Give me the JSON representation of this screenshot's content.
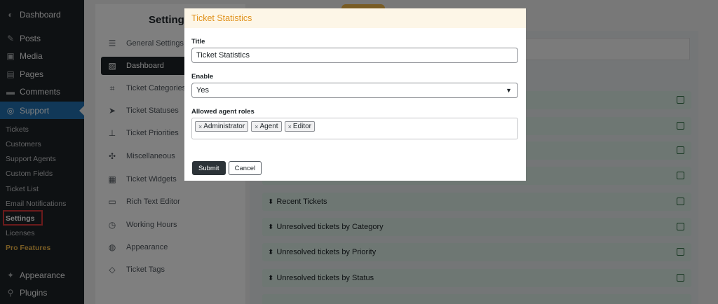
{
  "wp_menu": [
    {
      "label": "Dashboard",
      "icon": "dashboard-icon",
      "glyph": "◐"
    },
    {
      "label": "Posts",
      "icon": "pin-icon",
      "glyph": "✎"
    },
    {
      "label": "Media",
      "icon": "media-icon",
      "glyph": "▣"
    },
    {
      "label": "Pages",
      "icon": "pages-icon",
      "glyph": "▤"
    },
    {
      "label": "Comments",
      "icon": "comments-icon",
      "glyph": "▬"
    },
    {
      "label": "Support",
      "icon": "support-icon",
      "glyph": "◎"
    }
  ],
  "support_submenu": [
    "Tickets",
    "Customers",
    "Support Agents",
    "Custom Fields",
    "Ticket List",
    "Email Notifications",
    "Settings",
    "Licenses",
    "Pro Features"
  ],
  "wp_menu_bottom": [
    {
      "label": "Appearance",
      "icon": "appearance-icon",
      "glyph": "✦"
    },
    {
      "label": "Plugins",
      "icon": "plugins-icon",
      "glyph": "⚲"
    }
  ],
  "settings": {
    "title": "Settings",
    "items": [
      {
        "label": "General Settings",
        "icon": "sliders-icon",
        "glyph": "☰"
      },
      {
        "label": "Dashboard",
        "icon": "chart-icon",
        "glyph": "▨"
      },
      {
        "label": "Ticket Categories",
        "icon": "tag-icon",
        "glyph": "⌗"
      },
      {
        "label": "Ticket Statuses",
        "icon": "send-icon",
        "glyph": "➤"
      },
      {
        "label": "Ticket Priorities",
        "icon": "hierarchy-icon",
        "glyph": "⊥"
      },
      {
        "label": "Miscellaneous",
        "icon": "puzzle-icon",
        "glyph": "✣"
      },
      {
        "label": "Ticket Widgets",
        "icon": "widgets-icon",
        "glyph": "▦"
      },
      {
        "label": "Rich Text Editor",
        "icon": "editor-icon",
        "glyph": "▭"
      },
      {
        "label": "Working Hours",
        "icon": "clock-icon",
        "glyph": "◷"
      },
      {
        "label": "Appearance",
        "icon": "palette-icon",
        "glyph": "◍"
      },
      {
        "label": "Ticket Tags",
        "icon": "tags-icon",
        "glyph": "◇"
      }
    ]
  },
  "widgets": [
    "Recent Tickets",
    "Unresolved tickets by Category",
    "Unresolved tickets by Priority",
    "Unresolved tickets by Status"
  ],
  "modal": {
    "title": "Ticket Statistics",
    "title_label": "Title",
    "title_value": "Ticket Statistics",
    "enable_label": "Enable",
    "enable_value": "Yes",
    "roles_label": "Allowed agent roles",
    "roles": [
      "Administrator",
      "Agent",
      "Editor"
    ],
    "submit_label": "Submit",
    "cancel_label": "Cancel"
  },
  "colors": {
    "wp_sidebar": "#1d2327",
    "active_menu": "#2271b1",
    "modal_header_text": "#e0921c",
    "widget_row": "#dcefe6"
  }
}
